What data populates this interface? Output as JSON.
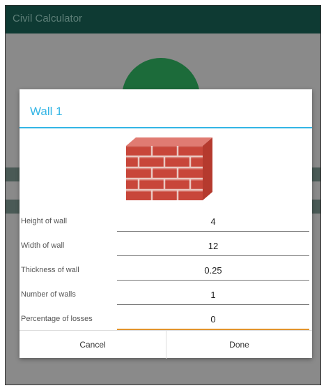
{
  "app": {
    "title": "Civil Calculator"
  },
  "dialog": {
    "title": "Wall  1",
    "image_icon": "brick-wall-icon",
    "fields": [
      {
        "label": "Height of wall",
        "value": "4"
      },
      {
        "label": "Width of wall",
        "value": "12"
      },
      {
        "label": "Thickness of wall",
        "value": "0.25"
      },
      {
        "label": "Number of walls",
        "value": "1"
      },
      {
        "label": "Percentage of losses",
        "value": "0"
      }
    ],
    "cancel_label": "Cancel",
    "done_label": "Done"
  },
  "colors": {
    "accent": "#33b5e5",
    "focus_underline": "#e2932b",
    "appbar": "#0e3a33"
  }
}
